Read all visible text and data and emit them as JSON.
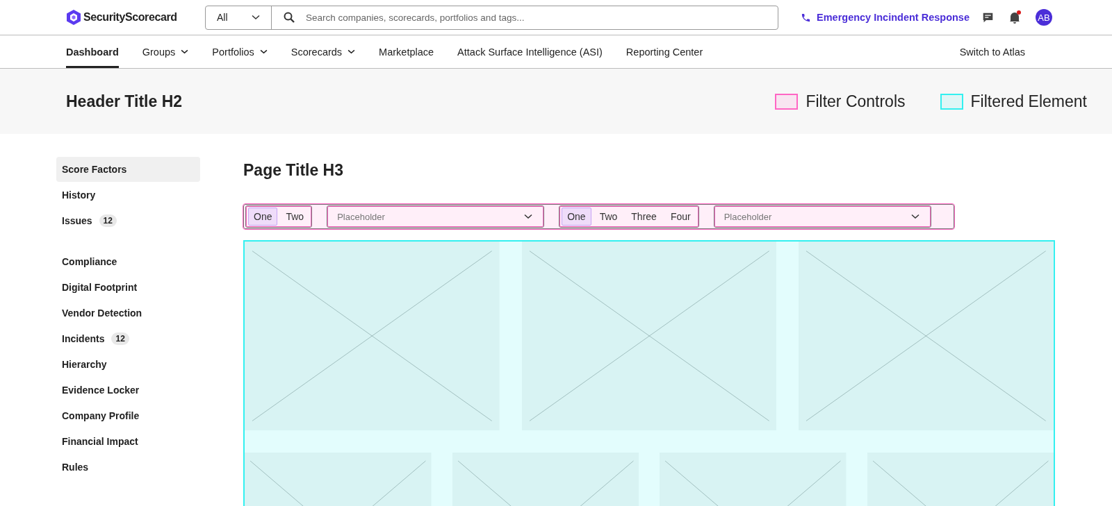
{
  "brand": {
    "name": "SecurityScorecard"
  },
  "search": {
    "scope": "All",
    "placeholder": "Search companies, scorecards, portfolios and tags..."
  },
  "emergency": {
    "label": "Emergency Incindent Response"
  },
  "notifications": {
    "unread": true
  },
  "avatar": {
    "initials": "AB"
  },
  "nav": [
    {
      "label": "Dashboard",
      "selected": true,
      "has_menu": false
    },
    {
      "label": "Groups",
      "selected": false,
      "has_menu": true
    },
    {
      "label": "Portfolios",
      "selected": false,
      "has_menu": true
    },
    {
      "label": "Scorecards",
      "selected": false,
      "has_menu": true
    },
    {
      "label": "Marketplace",
      "selected": false,
      "has_menu": false
    },
    {
      "label": "Attack Surface Intelligence (ASI)",
      "selected": false,
      "has_menu": false
    },
    {
      "label": "Reporting Center",
      "selected": false,
      "has_menu": false
    }
  ],
  "switch_link": "Switch to Atlas",
  "header": {
    "title": "Header Title H2",
    "legend": [
      {
        "label": "Filter Controls",
        "color": "#ff66c4"
      },
      {
        "label": "Filtered Element",
        "color": "#33f0f0"
      }
    ]
  },
  "sidebar": {
    "groups": [
      {
        "items": [
          {
            "label": "Score Factors",
            "selected": true
          },
          {
            "label": "History",
            "selected": false
          },
          {
            "label": "Issues",
            "selected": false,
            "badge": "12"
          }
        ]
      },
      {
        "items": [
          {
            "label": "Compliance",
            "selected": false
          },
          {
            "label": "Digital Footprint",
            "selected": false
          },
          {
            "label": "Vendor Detection",
            "selected": false
          },
          {
            "label": "Incidents",
            "selected": false,
            "badge": "12"
          },
          {
            "label": "Hierarchy",
            "selected": false
          },
          {
            "label": "Evidence Locker",
            "selected": false
          },
          {
            "label": "Company Profile",
            "selected": false
          },
          {
            "label": "Financial Impact",
            "selected": false
          },
          {
            "label": "Rules",
            "selected": false
          }
        ]
      }
    ]
  },
  "page_title": "Page Title H3",
  "filters": [
    {
      "kind": "segmented",
      "options": [
        {
          "label": "One",
          "selected": true
        },
        {
          "label": "Two",
          "selected": false
        }
      ]
    },
    {
      "kind": "dropdown",
      "placeholder": "Placeholder"
    },
    {
      "kind": "segmented",
      "options": [
        {
          "label": "One",
          "selected": true
        },
        {
          "label": "Two",
          "selected": false
        },
        {
          "label": "Three",
          "selected": false
        },
        {
          "label": "Four",
          "selected": false
        }
      ]
    },
    {
      "kind": "dropdown",
      "placeholder": "Placeholder"
    }
  ],
  "gallery": {
    "rows": [
      {
        "tiles": [
          {
            "kind": "image-placeholder"
          },
          {
            "kind": "image-placeholder"
          },
          {
            "kind": "image-placeholder"
          }
        ]
      },
      {
        "tiles": [
          {
            "kind": "image-placeholder"
          },
          {
            "kind": "image-placeholder"
          },
          {
            "kind": "image-placeholder"
          },
          {
            "kind": "image-placeholder"
          }
        ]
      }
    ]
  }
}
